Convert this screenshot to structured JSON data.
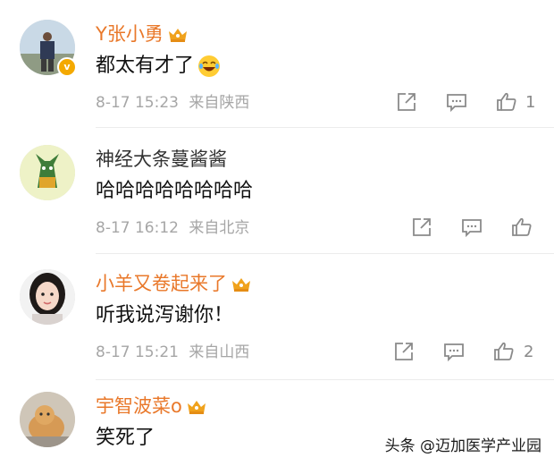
{
  "comments": [
    {
      "username": "Y张小勇",
      "vip": true,
      "text": "都太有才了",
      "date": "8-17 15:23",
      "location": "来自陕西",
      "likes": "1"
    },
    {
      "username": "神经大条蔓酱酱",
      "vip": false,
      "text": "哈哈哈哈哈哈哈哈",
      "date": "8-17 16:12",
      "location": "来自北京",
      "likes": ""
    },
    {
      "username": "小羊又卷起来了",
      "vip": true,
      "text": "听我说泻谢你！",
      "date": "8-17 15:21",
      "location": "来自山西",
      "likes": "2"
    },
    {
      "username": "宇智波菜o",
      "vip": true,
      "text": "笑死了",
      "date": "",
      "location": "",
      "likes": ""
    }
  ],
  "watermark": "头条 @迈加医学产业园",
  "colors": {
    "vip_name": "#e9782a",
    "crown": "#f0a21c",
    "meta": "#a6a6a6"
  },
  "icons": [
    "share-icon",
    "comment-icon",
    "like-icon",
    "crown-icon",
    "laugh-emoji-icon",
    "verified-badge-icon"
  ]
}
